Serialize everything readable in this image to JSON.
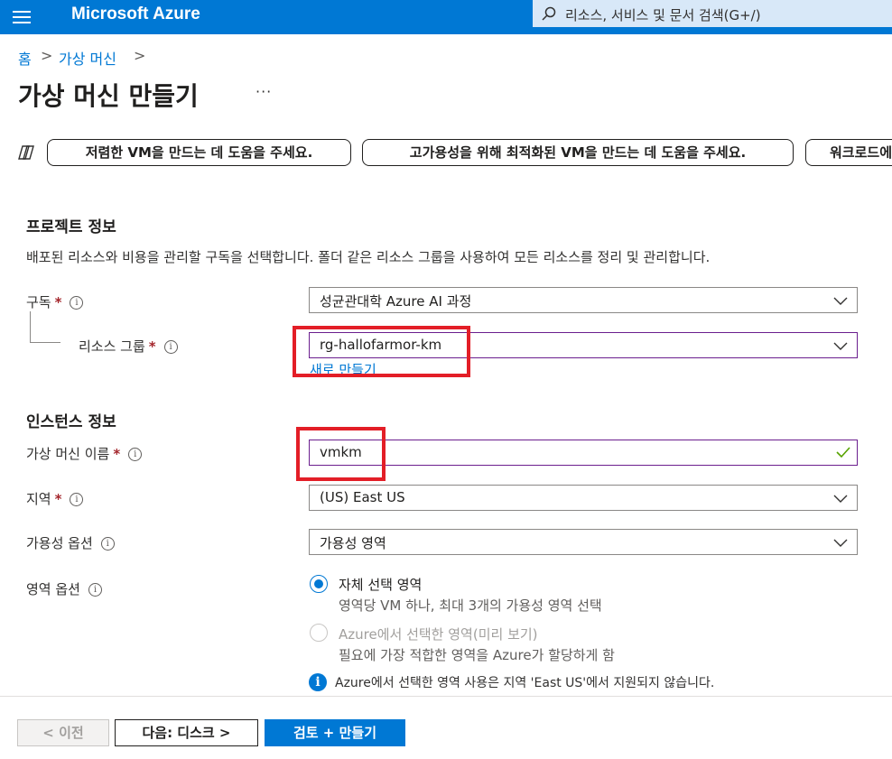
{
  "topbar": {
    "brand": "Microsoft Azure",
    "search_placeholder": "리소스, 서비스 및 문서 검색(G+/)"
  },
  "breadcrumb": {
    "home": "홈",
    "sep1": ">",
    "vm": "가상 머신",
    "sep2": ">"
  },
  "page": {
    "title": "가상 머신 만들기",
    "more": "···"
  },
  "copilot": {
    "pills": [
      "저렴한 VM을 만드는 데 도움을 주세요.",
      "고가용성을 위해 최적화된 VM을 만드는 데 도움을 주세요.",
      "워크로드에"
    ]
  },
  "project": {
    "heading": "프로젝트 정보",
    "description": "배포된 리소스와 비용을 관리할 구독을 선택합니다. 폴더 같은 리소스 그룹을 사용하여 모든 리소스를 정리 및 관리합니다.",
    "subscription_label": "구독",
    "subscription_value": "성균관대학 Azure AI 과정",
    "resource_group_label": "리소스 그룹",
    "resource_group_value": "rg-hallofarmor-km",
    "create_new": "새로 만들기"
  },
  "instance": {
    "heading": "인스턴스 정보",
    "vm_name_label": "가상 머신 이름",
    "vm_name_value": "vmkm",
    "region_label": "지역",
    "region_value": "(US) East US",
    "availability_label": "가용성 옵션",
    "availability_value": "가용성 영역",
    "zone_label": "영역 옵션",
    "zone_options": [
      {
        "title": "자체 선택 영역",
        "subtitle": "영역당 VM 하나, 최대 3개의 가용성 영역 선택",
        "selected": true
      },
      {
        "title": "Azure에서 선택한 영역(미리 보기)",
        "subtitle": "필요에 가장 적합한 영역을 Azure가 할당하게 함",
        "selected": false
      }
    ],
    "zone_note": "Azure에서 선택한 영역 사용은 지역 'East US'에서 지원되지 않습니다."
  },
  "required_mark": "*",
  "info_mark": "i",
  "footer": {
    "prev": "< 이전",
    "next": "다음: 디스크 >",
    "create": "검토 + 만들기"
  },
  "colors": {
    "accent": "#0078d4",
    "highlight_box": "#e31e27",
    "required": "#a4262c"
  }
}
